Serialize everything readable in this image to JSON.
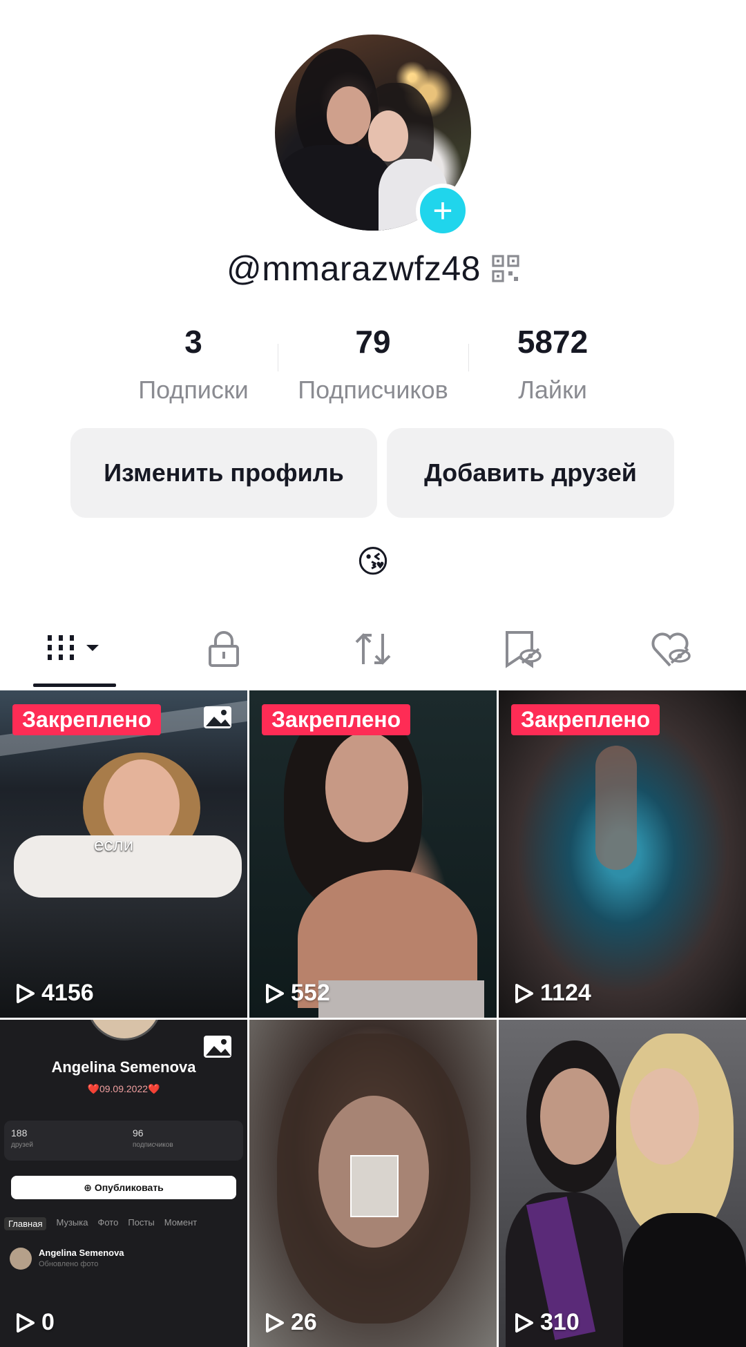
{
  "profile": {
    "username": "@mmarazwfz48",
    "stats": [
      {
        "value": "3",
        "label": "Подписки"
      },
      {
        "value": "79",
        "label": "Подписчиков"
      },
      {
        "value": "5872",
        "label": "Лайки"
      }
    ],
    "edit_button": "Изменить профиль",
    "add_friends_button": "Добавить друзей",
    "bio": "😘"
  },
  "tabs": [
    {
      "icon": "videos-grid-icon",
      "active": true
    },
    {
      "icon": "lock-icon"
    },
    {
      "icon": "repost-icon"
    },
    {
      "icon": "favorites-hidden-icon"
    },
    {
      "icon": "liked-hidden-icon"
    }
  ],
  "videos": [
    {
      "pinned": "Закреплено",
      "views": "4156",
      "caption": "если",
      "photo_mode": true
    },
    {
      "pinned": "Закреплено",
      "views": "552"
    },
    {
      "pinned": "Закреплено",
      "views": "1124"
    },
    {
      "views": "0",
      "photo_mode": true,
      "screenshot": {
        "name": "Angelina Semenova",
        "date": "09.09.2022",
        "friends": "188",
        "friends_label": "друзей",
        "followers": "96",
        "followers_label": "подписчиков",
        "publish": "Опубликовать",
        "tabs": [
          "Главная",
          "Музыка",
          "Фото",
          "Посты",
          "Момент"
        ],
        "post_author": "Angelina Semenova",
        "post_sub": "Обновлено фото"
      }
    },
    {
      "views": "26"
    },
    {
      "views": "310"
    }
  ],
  "colors": {
    "accent": "#fe2c55",
    "plus": "#20d5ec",
    "button_bg": "#f1f1f2"
  }
}
